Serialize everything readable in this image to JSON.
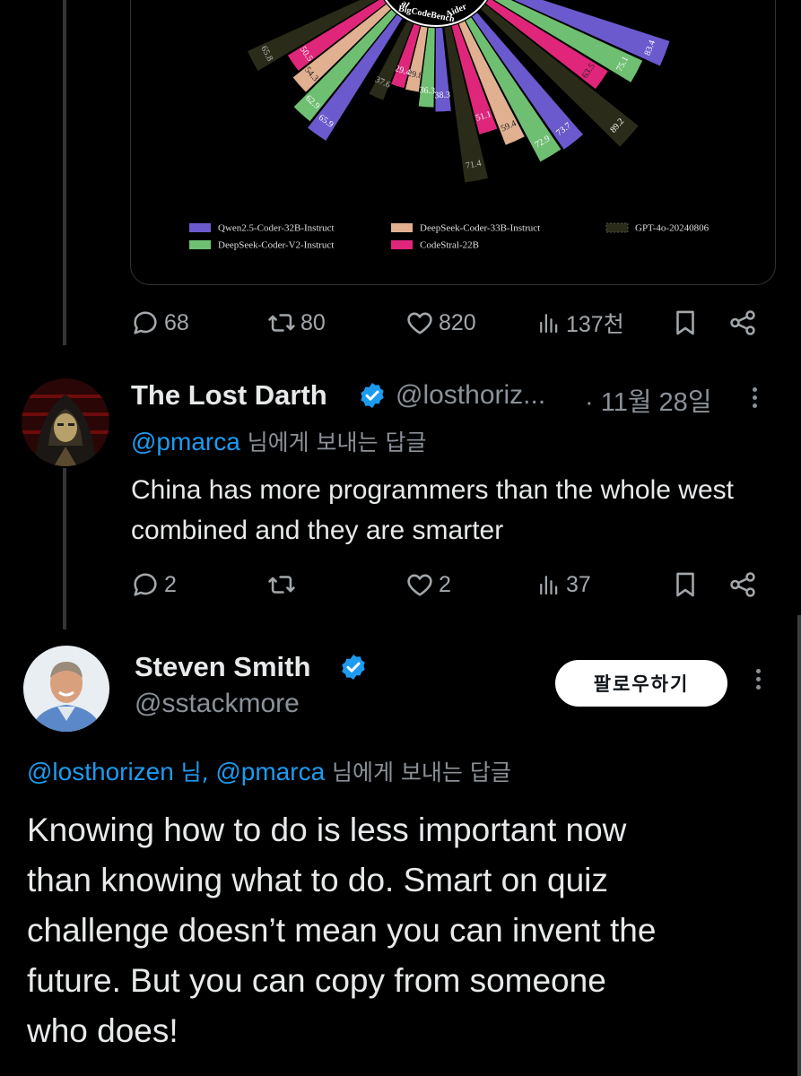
{
  "chart_data": {
    "type": "bar",
    "layout": "radial",
    "categories": [
      "BigCodeBench",
      "Aider"
    ],
    "series": [
      {
        "name": "Qwen2.5-Coder-32B-Instruct",
        "values": [
          38.3,
          73.7
        ],
        "color": "#6a5acd"
      },
      {
        "name": "DeepSeek-Coder-V2-Instruct",
        "values": [
          36.3,
          72.9
        ],
        "color": "#6fbf73"
      },
      {
        "name": "DeepSeek-Coder-33B-Instruct",
        "values": [
          29.8,
          59.4
        ],
        "color": "#e0b090"
      },
      {
        "name": "CodeStral-22B",
        "values": [
          29.4,
          51.1
        ],
        "color": "#e0267a"
      },
      {
        "name": "GPT-4o-20240806",
        "values": [
          37.6,
          71.4
        ],
        "color": "#2b2b1a"
      }
    ],
    "partial_groups": [
      {
        "label": "al",
        "values": [
          65.9,
          62.9,
          54.3,
          50.5,
          65.8
        ]
      },
      {
        "label": "",
        "values": [
          83.4,
          75.1,
          63.5,
          89.2
        ]
      }
    ],
    "legend": [
      {
        "label": "Qwen2.5-Coder-32B-Instruct",
        "color": "#6a5acd"
      },
      {
        "label": "DeepSeek-Coder-33B-Instruct",
        "color": "#e0b090"
      },
      {
        "label": "GPT-4o-20240806",
        "color": "#2b2b1a"
      },
      {
        "label": "DeepSeek-Coder-V2-Instruct",
        "color": "#6fbf73"
      },
      {
        "label": "CodeStral-22B",
        "color": "#e0267a"
      }
    ],
    "legend_position": "bottom"
  },
  "top_actions": {
    "replies": "68",
    "reposts": "80",
    "likes": "820",
    "views": "137천"
  },
  "reply1": {
    "name": "The Lost Darth",
    "handle": "@losthoriz...",
    "time": "· 11월 28일",
    "reply_to_handle": "@pmarca",
    "reply_to_suffix": "님에게 보내는 답글",
    "text": "China has more programmers than the whole west combined and they are smarter",
    "actions": {
      "replies": "2",
      "reposts": "",
      "likes": "2",
      "views": "37"
    }
  },
  "reply2": {
    "name": "Steven Smith",
    "handle": "@sstackmore",
    "follow_label": "팔로우하기",
    "reply_to_1": "@losthorizen",
    "reply_to_sep": "님,",
    "reply_to_2": "@pmarca",
    "reply_to_suffix": "님에게 보내는 답글",
    "text_lines": [
      "Knowing how to do is less important now",
      "than knowing what to do.  Smart on quiz",
      "challenge doesn’t mean you can invent the",
      "future.  But you can copy from someone",
      "who does!"
    ]
  },
  "colors": {
    "accent": "#1d9bf0",
    "verified": "#1d9bf0",
    "muted": "#8b9198",
    "background": "#000000"
  }
}
